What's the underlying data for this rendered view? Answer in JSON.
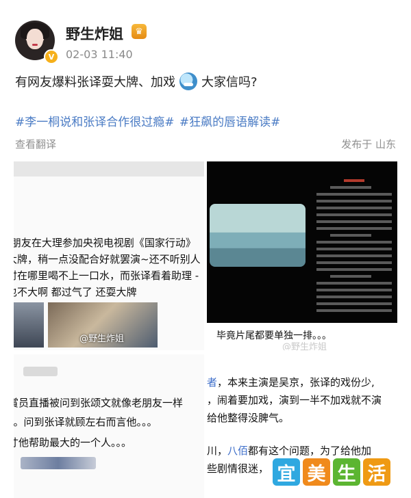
{
  "post": {
    "username": "野生炸姐",
    "timestamp": "02-03 11:40",
    "text_before_emoji": "有网友爆料张译耍大牌、加戏",
    "text_after_emoji": "大家信吗?",
    "hashtags": [
      "#李一桐说和张译合作很过瘾#",
      "#狂飙的唇语解读#"
    ],
    "translate_label": "查看翻译",
    "location_label": "发布于 山东"
  },
  "images": {
    "img1": {
      "lines": [
        "]朋友在大理参加央视电视剧《国家行动》",
        "大牌，稍一点没配合好就罢演~还不听别人",
        "时在哪里喝不上一口水，而张译看着助理 -",
        "也不大啊 都过气了 还耍大牌"
      ],
      "watermark": "@野生炸姐"
    },
    "img2": {
      "caption": "毕竟片尾都要单独一排。。。",
      "watermark": "@野生炸姐"
    },
    "img3": {
      "lines": [
        "賞员直播被问到张颂文就像老朋友一样",
        "。。问到张译就顾左右而言他。。。",
        "寸他帮助最大的一个人。。。"
      ]
    },
    "img4": {
      "line1_prefix": "者",
      "line1_rest": "，本来主演是吴京，张译的戏份少,",
      "line2": "，闹着要加戏，演到一半不加戏就不演",
      "line3": "给他整得没脾气。",
      "line4_prefix": "川，",
      "line4_blue": "八佰",
      "line4_rest": "都有这个问题，为了给他加",
      "line5": "些剧情很迷，"
    }
  },
  "logo": {
    "chars": [
      "宜",
      "美",
      "生",
      "活"
    ],
    "colors": [
      "#2fa8e0",
      "#f08a1c",
      "#5cb531",
      "#ef9a14"
    ]
  }
}
